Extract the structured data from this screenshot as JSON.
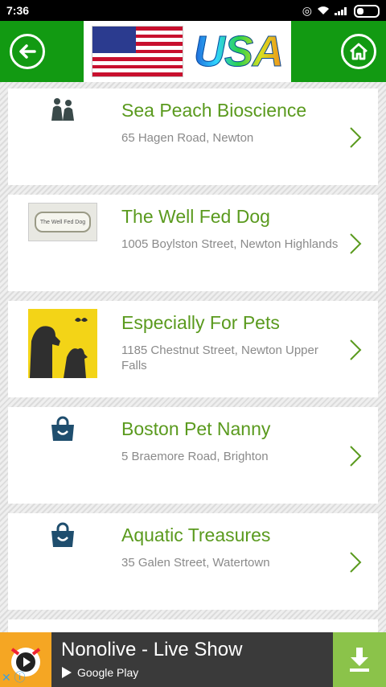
{
  "status_bar": {
    "time": "7:36"
  },
  "header": {
    "banner_text": "USA"
  },
  "listings": [
    {
      "name": "Sea Peach Bioscience",
      "address": "65 Hagen Road, Newton",
      "icon": "pets-icon"
    },
    {
      "name": "The Well Fed Dog",
      "address": "1005 Boylston Street, Newton Highlands",
      "icon": "bone-logo",
      "logo_text": "The Well Fed Dog"
    },
    {
      "name": "Especially For Pets",
      "address": "1185 Chestnut Street, Newton Upper Falls",
      "icon": "pets-silhouette-image"
    },
    {
      "name": "Boston Pet Nanny",
      "address": "5 Braemore Road, Brighton",
      "icon": "shopping-bag-icon"
    },
    {
      "name": "Aquatic Treasures",
      "address": "35 Galen Street, Watertown",
      "icon": "shopping-bag-icon"
    }
  ],
  "ad": {
    "title": "Nonolive - Live Show",
    "store_label": "Google Play"
  },
  "colors": {
    "header_green": "#129a12",
    "name_green": "#5a9a1e",
    "address_gray": "#8a8a8a",
    "ad_button_green": "#8bc34a"
  }
}
